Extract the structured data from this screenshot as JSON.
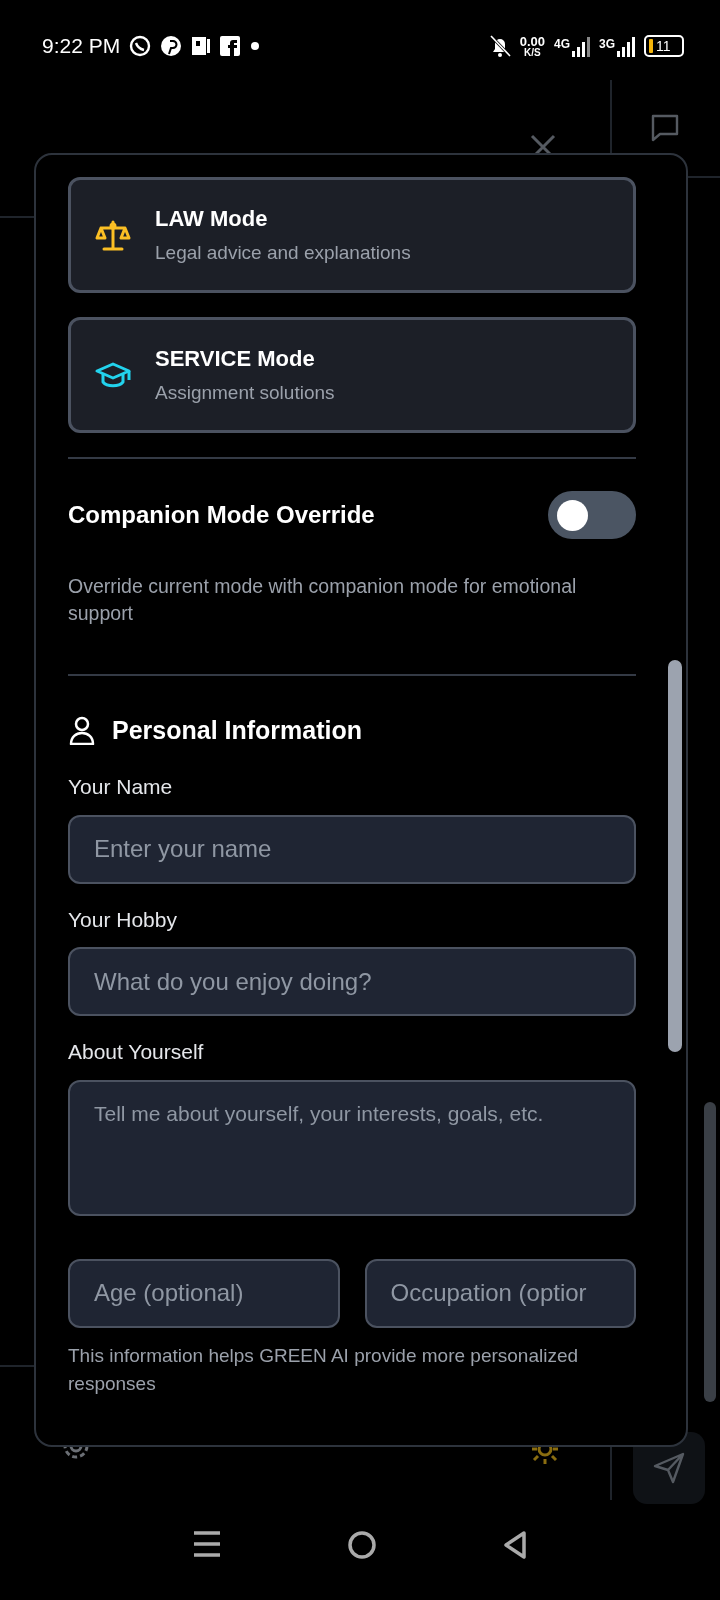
{
  "status_bar": {
    "time": "9:22 PM",
    "speed_value": "0.00",
    "speed_unit": "K/S",
    "network_1": "4G",
    "network_2": "3G",
    "battery": "11"
  },
  "modal": {
    "modes": [
      {
        "kind": "law",
        "title": "LAW Mode",
        "description": "Legal advice and explanations"
      },
      {
        "kind": "service",
        "title": "SERVICE Mode",
        "description": "Assignment solutions"
      }
    ],
    "companion_override": {
      "label": "Companion Mode Override",
      "on": false,
      "description": "Override current mode with companion mode for emotional support"
    },
    "personal_info": {
      "heading": "Personal Information",
      "fields": [
        {
          "label": "Your Name",
          "placeholder": "Enter your name",
          "kind": "input"
        },
        {
          "label": "Your Hobby",
          "placeholder": "What do you enjoy doing?",
          "kind": "input"
        },
        {
          "label": "About Yourself",
          "placeholder": "Tell me about yourself, your interests, goals, etc.",
          "kind": "textarea"
        }
      ],
      "inline_fields": [
        {
          "placeholder": "Age (optional)"
        },
        {
          "placeholder": "Occupation (optior"
        }
      ],
      "note": "This information helps GREEN AI provide more personalized responses"
    }
  }
}
